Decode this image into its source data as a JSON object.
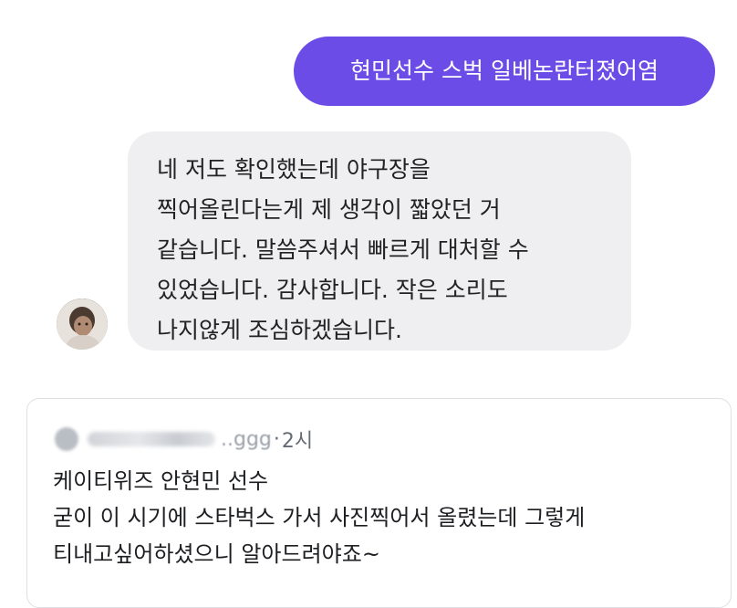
{
  "chat": {
    "sent_message": "현민선수 스벅 일베논란터졌어염",
    "sent_bubble_color": "#6c4ce6",
    "received_message_lines": [
      "네 저도 확인했는데 야구장을",
      "찍어올린다는게 제 생각이 짧았던 거",
      "같습니다. 말씀주셔서 빠르게 대처할 수",
      "있었습니다. 감사합니다. 작은 소리도",
      "나지않게 조심하겠습니다."
    ],
    "received_bubble_color": "#efeff2"
  },
  "comment": {
    "author_suffix": "..ggg",
    "separator": "·",
    "time_ago": "2시",
    "body_lines": [
      "케이티위즈 안현민 선수",
      "굳이 이 시기에 스타벅스 가서 사진찍어서 올렸는데 그렇게",
      "티내고싶어하셨으니 알아드려야죠~"
    ]
  }
}
